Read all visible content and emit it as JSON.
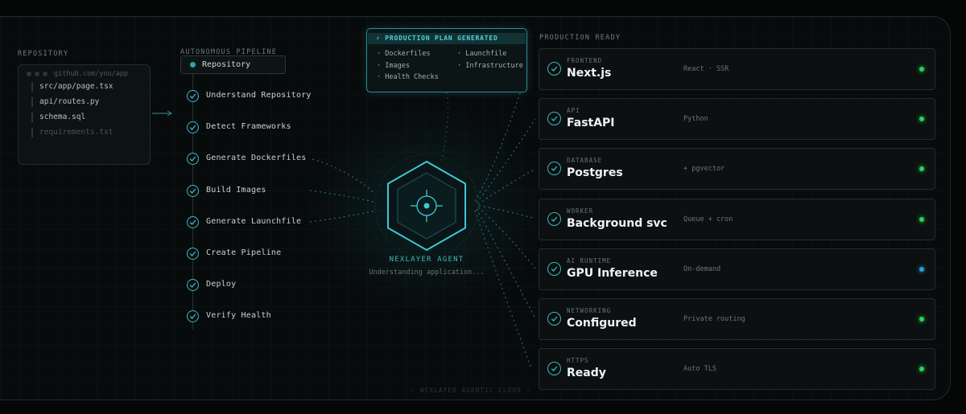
{
  "sections": {
    "repository": "REPOSITORY",
    "pipeline": "AUTONOMOUS PIPELINE",
    "production": "PRODUCTION READY"
  },
  "repo": {
    "url": "github.com/you/app",
    "files": [
      "src/app/page.tsx",
      "api/routes.py",
      "schema.sql",
      "requirements.txt"
    ]
  },
  "pipeline": {
    "head": "Repository",
    "steps": [
      "Understand Repository",
      "Detect Frameworks",
      "Generate Dockerfiles",
      "Build Images",
      "Generate Launchfile",
      "Create Pipeline",
      "Deploy",
      "Verify Health"
    ]
  },
  "plan": {
    "title": "⚡ PRODUCTION PLAN GENERATED",
    "items": [
      "· Dockerfiles",
      "· Launchfile",
      "· Images",
      "· Infrastructure",
      "· Health Checks"
    ]
  },
  "agent": {
    "title": "NEXLAYER AGENT",
    "status": "Understanding application..."
  },
  "services": [
    {
      "category": "FRONTEND",
      "name": "Next.js",
      "note": "React · SSR",
      "status": "green"
    },
    {
      "category": "API",
      "name": "FastAPI",
      "note": "Python",
      "status": "green"
    },
    {
      "category": "DATABASE",
      "name": "Postgres",
      "note": "+ pgvector",
      "status": "green"
    },
    {
      "category": "WORKER",
      "name": "Background svc",
      "note": "Queue + cron",
      "status": "green"
    },
    {
      "category": "AI RUNTIME",
      "name": "GPU Inference",
      "note": "On-demand",
      "status": "blue"
    },
    {
      "category": "NETWORKING",
      "name": "Configured",
      "note": "Private routing",
      "status": "green"
    },
    {
      "category": "HTTPS",
      "name": "Ready",
      "note": "Auto TLS",
      "status": "green"
    }
  ],
  "footer": "— NEXLAYER AGENTIC CLOUD —",
  "colors": {
    "accent": "#3fb6c2",
    "status_green": "#2bd15a",
    "status_blue": "#2a9fd8"
  }
}
